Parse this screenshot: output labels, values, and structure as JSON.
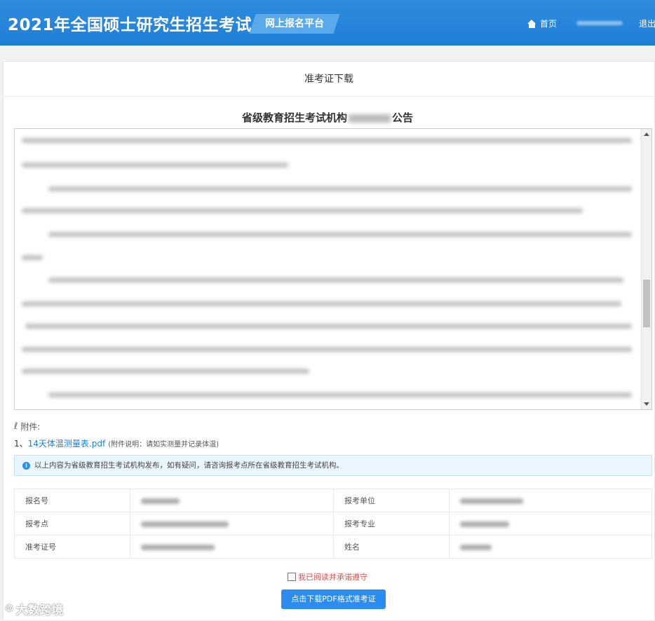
{
  "header": {
    "title": "2021年全国硕士研究生招生考试",
    "platform": "网上报名平台",
    "home": "首页",
    "logout": "退出"
  },
  "panel": {
    "title": "准考证下载"
  },
  "notice": {
    "title_prefix": "省级教育招生考试机构",
    "title_suffix": "公告"
  },
  "attachment": {
    "label": "附件:",
    "index": "1、",
    "file_name": "14天体温测量表.pdf",
    "note": "(附件说明：请如实测量并记录体温)"
  },
  "alert": {
    "text": "以上内容为省级教育招生考试机构发布，如有疑问，请咨询报考点所在省级教育招生考试机构。"
  },
  "info_table": {
    "rows": [
      {
        "label_left": "报名号",
        "label_right": "报考单位"
      },
      {
        "label_left": "报考点",
        "label_right": "报考专业"
      },
      {
        "label_left": "准考证号",
        "label_right": "姓名"
      }
    ]
  },
  "agreement": {
    "label": "我已阅读并承诺遵守"
  },
  "download_button": {
    "label": "点击下载PDF格式准考证"
  },
  "watermark": {
    "text": "大数跨境"
  },
  "icons": {
    "home": "home-icon",
    "attachment": "paperclip-icon",
    "info": "info-icon"
  },
  "colors": {
    "header_blue": "#1f7fd6",
    "button_blue": "#2d8cf0",
    "link_blue": "#1f7fd6",
    "agree_red": "#d9534f"
  }
}
